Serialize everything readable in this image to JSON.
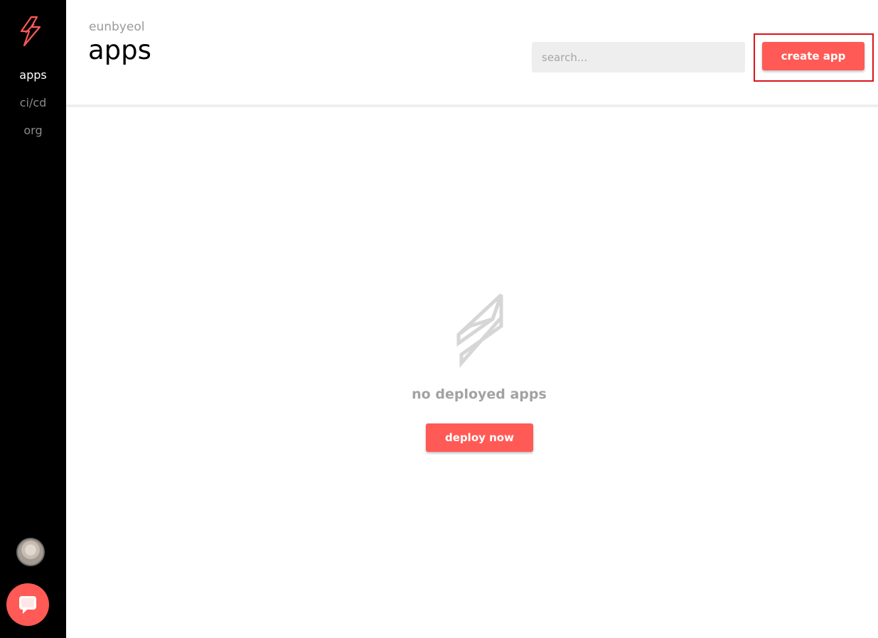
{
  "sidebar": {
    "logo_icon": "bolt-icon",
    "nav": [
      {
        "label": "apps",
        "active": true
      },
      {
        "label": "ci/cd",
        "active": false
      },
      {
        "label": "org",
        "active": false
      }
    ],
    "avatar_icon": "user-avatar",
    "chat_icon": "chat-bubble-icon"
  },
  "header": {
    "org_name": "eunbyeol",
    "title": "apps",
    "search_placeholder": "search...",
    "search_value": "",
    "create_label": "create app"
  },
  "empty_state": {
    "icon": "bolt-outline-icon",
    "message": "no deployed apps",
    "action_label": "deploy now"
  },
  "colors": {
    "accent": "#ff5a55",
    "sidebar_bg": "#000000",
    "highlight": "#d9141b"
  }
}
